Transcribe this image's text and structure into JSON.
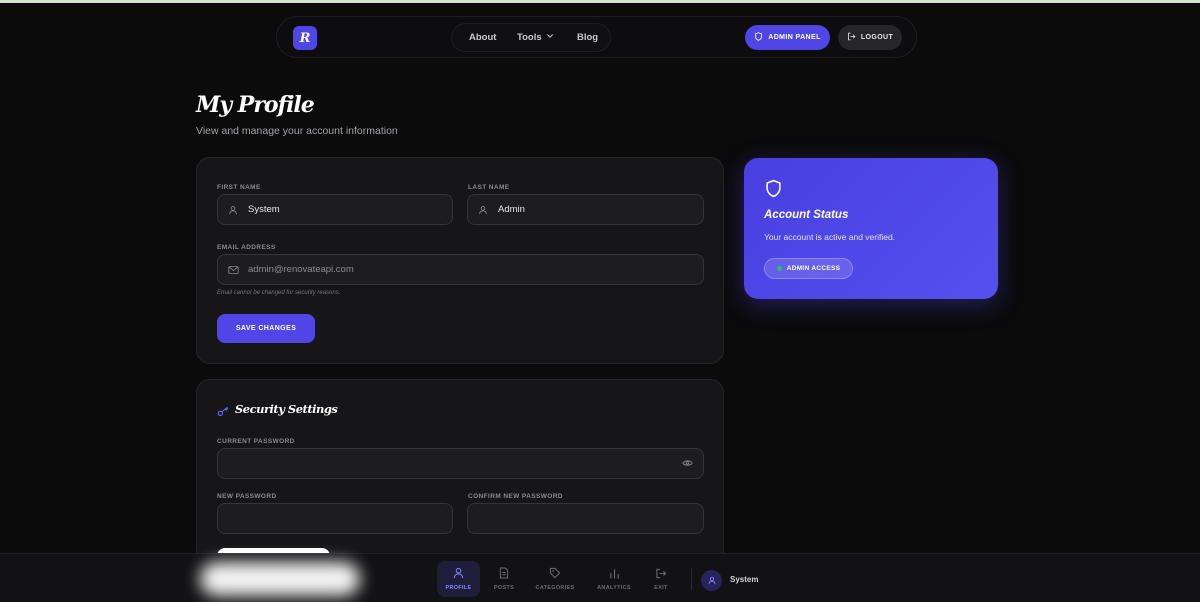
{
  "navbar": {
    "logo_letter": "R",
    "links": [
      "About",
      "Tools",
      "Blog"
    ],
    "admin_button": "ADMIN PANEL",
    "logout_button": "LOGOUT"
  },
  "page": {
    "title": "My Profile",
    "subtitle": "View and manage your account information"
  },
  "profile_form": {
    "first_name_label": "FIRST NAME",
    "first_name_value": "System",
    "last_name_label": "LAST NAME",
    "last_name_value": "Admin",
    "email_label": "EMAIL ADDRESS",
    "email_value": "admin@renovateapi.com",
    "email_note": "Email cannot be changed for security reasons.",
    "save_button": "SAVE CHANGES"
  },
  "security": {
    "title": "Security Settings",
    "current_password_label": "CURRENT PASSWORD",
    "new_password_label": "NEW PASSWORD",
    "confirm_password_label": "CONFIRM NEW PASSWORD"
  },
  "status_card": {
    "title": "Account Status",
    "text": "Your account is active and verified.",
    "badge": "ADMIN ACCESS",
    "badge_dot_color": "#22c55e"
  },
  "dock": {
    "items": [
      {
        "label": "PROFILE",
        "icon": "user-icon",
        "active": true
      },
      {
        "label": "POSTS",
        "icon": "document-icon",
        "active": false
      },
      {
        "label": "CATEGORIES",
        "icon": "tag-icon",
        "active": false
      },
      {
        "label": "ANALYTICS",
        "icon": "bar-chart-icon",
        "active": false
      },
      {
        "label": "EXIT",
        "icon": "exit-icon",
        "active": false
      }
    ],
    "user_name": "System"
  },
  "colors": {
    "accent": "#4f46e5",
    "background": "#0b0b0c",
    "card": "#161618"
  }
}
